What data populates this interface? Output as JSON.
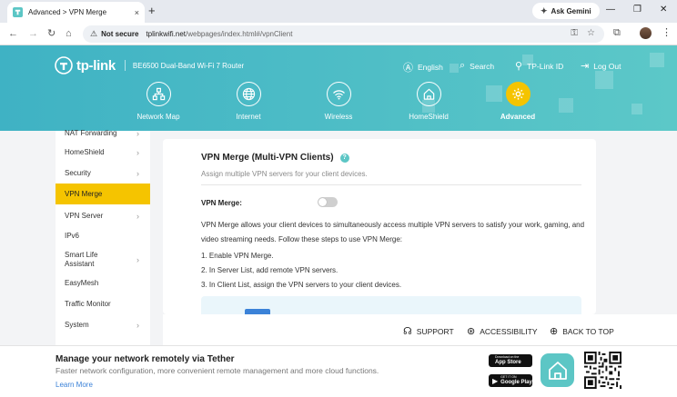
{
  "browser": {
    "tab_title": "Advanced > VPN Merge",
    "tab_close": "×",
    "new_tab": "+",
    "ask_gemini": "Ask Gemini",
    "not_secure": "Not secure",
    "url_host": "tplinkwifi.net",
    "url_path": "/webpages/index.html#/vpnClient"
  },
  "router": {
    "brand": "tp-link",
    "model": "BE6500 Dual-Band Wi-Fi 7 Router",
    "top_menu": {
      "language": "English",
      "search": "Search",
      "tplink_id": "TP-Link ID",
      "logout": "Log Out"
    },
    "nav": [
      {
        "label": "Network Map"
      },
      {
        "label": "Internet"
      },
      {
        "label": "Wireless"
      },
      {
        "label": "HomeShield"
      },
      {
        "label": "Advanced"
      }
    ],
    "accent": "#f5c400",
    "header_color": "#4dbfc6"
  },
  "sidebar": {
    "items": [
      {
        "label": "NAT Forwarding"
      },
      {
        "label": "HomeShield"
      },
      {
        "label": "Security"
      },
      {
        "label": "VPN Merge"
      },
      {
        "label": "VPN Server"
      },
      {
        "label": "IPv6"
      },
      {
        "label": "Smart Life Assistant"
      },
      {
        "label": "EasyMesh"
      },
      {
        "label": "Traffic Monitor"
      },
      {
        "label": "System"
      }
    ]
  },
  "content": {
    "title": "VPN Merge (Multi-VPN Clients)",
    "help": "?",
    "subtitle": "Assign multiple VPN servers for your client devices.",
    "toggle_label": "VPN Merge:",
    "toggle_on": false,
    "description": "VPN Merge allows your client devices to simultaneously access multiple VPN servers to satisfy your work, gaming, and video streaming needs. Follow these steps to use VPN Merge:",
    "steps": [
      "1. Enable VPN Merge.",
      "2. In Server List, add remote VPN servers.",
      "3. In Client List, assign the VPN servers to your client devices."
    ]
  },
  "footer": {
    "support": "SUPPORT",
    "accessibility": "ACCESSIBILITY",
    "back_to_top": "BACK TO TOP"
  },
  "banner": {
    "title": "Manage your network remotely via Tether",
    "subtitle": "Faster network configuration, more convenient remote management and more cloud functions.",
    "learn_more": "Learn More",
    "app_store_small": "Download on the",
    "app_store": "App Store",
    "google_play_small": "GET IT ON",
    "google_play": "Google Play"
  }
}
